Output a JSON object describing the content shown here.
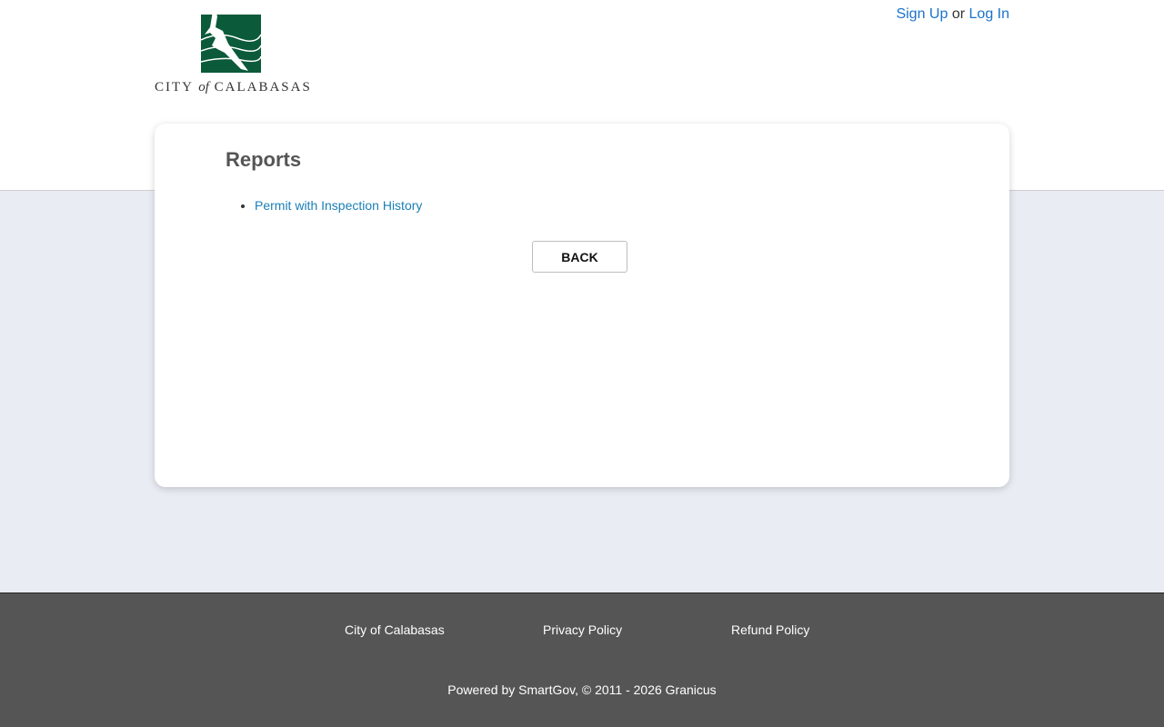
{
  "header": {
    "logo_text_city": "City",
    "logo_text_of": "of",
    "logo_text_name": "Calabasas",
    "logo_colors": {
      "green": "#0b5a3a"
    },
    "auth": {
      "signup_label": "Sign Up",
      "separator": "or",
      "login_label": "Log In"
    }
  },
  "main": {
    "title": "Reports",
    "reports": [
      "Permit with Inspection History"
    ],
    "back_label": "BACK"
  },
  "footer": {
    "links": [
      "City of Calabasas",
      "Privacy Policy",
      "Refund Policy"
    ],
    "powered_by": "Powered by SmartGov, © 2011 - 2026 Granicus"
  },
  "colors": {
    "link": "#1a73c9",
    "report_link": "#1a7fb5",
    "background": "#e9ecf3",
    "footer_bg": "#555555"
  }
}
